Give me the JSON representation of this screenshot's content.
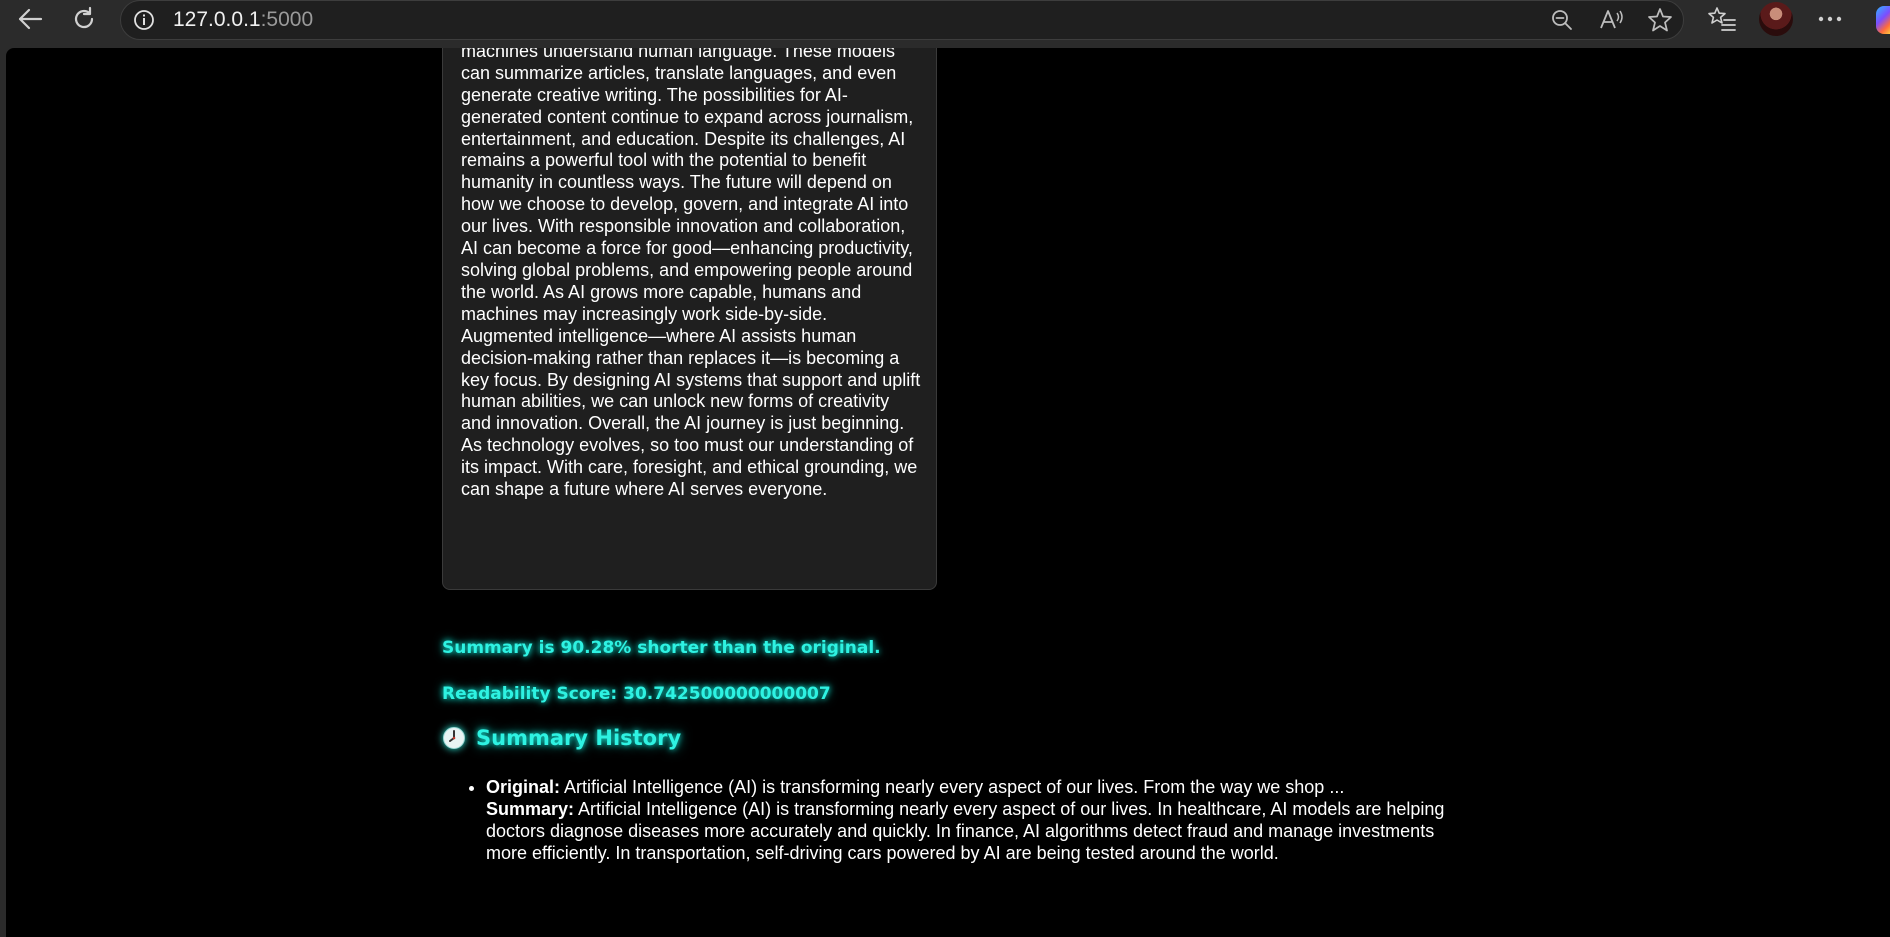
{
  "browser": {
    "url_host": "127.0.0.1",
    "url_port": ":5000",
    "icons": [
      "back-icon",
      "refresh-icon",
      "site-info-icon",
      "zoom-out-icon",
      "read-aloud-icon",
      "favorite-star-icon",
      "favorites-list-icon",
      "profile-avatar",
      "more-menu-icon",
      "copilot-icon"
    ]
  },
  "card": {
    "text": "tools like GPT and BERT have revolutionized how machines understand human language. These models can summarize articles, translate languages, and even generate creative writing. The possibilities for AI-generated content continue to expand across journalism, entertainment, and education. Despite its challenges, AI remains a powerful tool with the potential to benefit humanity in countless ways. The future will depend on how we choose to develop, govern, and integrate AI into our lives. With responsible innovation and collaboration, AI can become a force for good—enhancing productivity, solving global problems, and empowering people around the world. As AI grows more capable, humans and machines may increasingly work side-by-side. Augmented intelligence—where AI assists human decision-making rather than replaces it—is becoming a key focus. By designing AI systems that support and uplift human abilities, we can unlock new forms of creativity and innovation. Overall, the AI journey is just beginning. As technology evolves, so too must our understanding of its impact. With care, foresight, and ethical grounding, we can shape a future where AI serves everyone."
  },
  "stats": {
    "shorter": "Summary is 90.28% shorter than the original.",
    "readability": "Readability Score: 30.742500000000007"
  },
  "history": {
    "title": "Summary History",
    "items": [
      {
        "original_label": "Original:",
        "original_text": " Artificial Intelligence (AI) is transforming nearly every aspect of our lives. From the way we shop ...",
        "summary_label": "Summary:",
        "summary_text": " Artificial Intelligence (AI) is transforming nearly every aspect of our lives. In healthcare, AI models are helping doctors diagnose diseases more accurately and quickly. In finance, AI algorithms detect fraud and manage investments more efficiently. In transportation, self-driving cars powered by AI are being tested around the world."
      }
    ]
  },
  "colors": {
    "accent": "#2ef2e2",
    "page_bg": "#000000",
    "card_bg": "#1f1f1f",
    "browser_bg": "#2b2b2b"
  }
}
